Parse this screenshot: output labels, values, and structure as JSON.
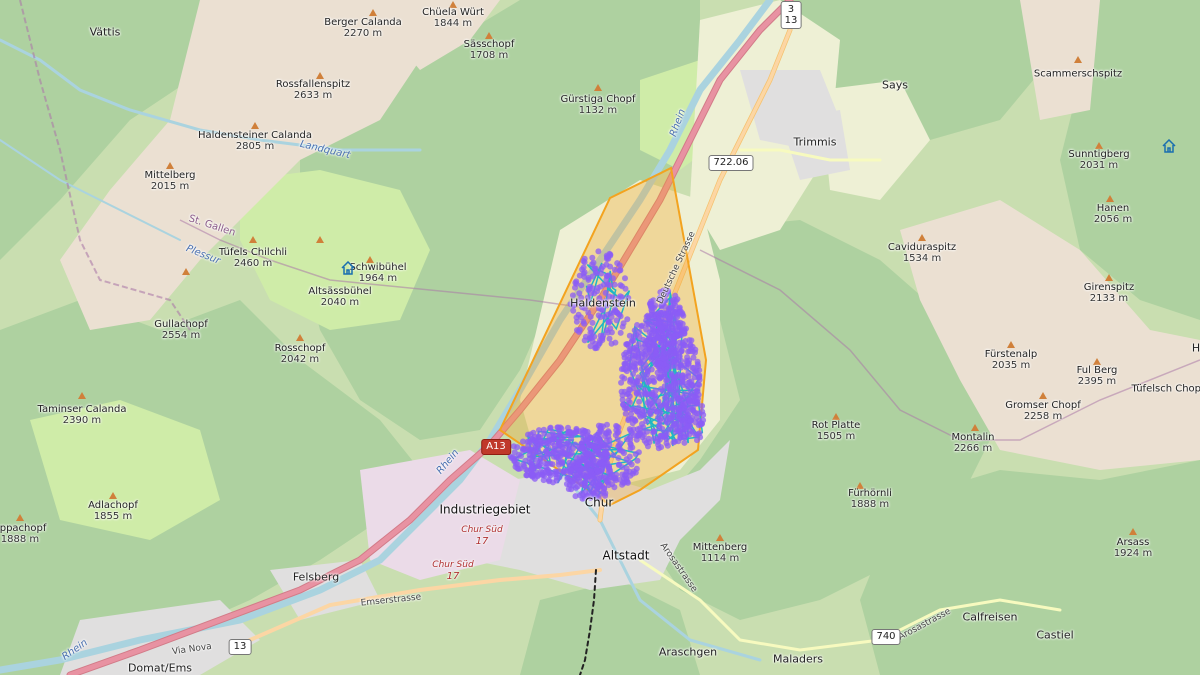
{
  "map": {
    "colors": {
      "forest": "#aed1a0",
      "meadow": "#cfeca8",
      "rock": "#ede3d6",
      "residential": "#e0dfdf",
      "industrial": "#ebdbe8",
      "farmland": "#eef0d5",
      "water": "#aad3df",
      "motorway": "#e892a2",
      "primary": "#fcd6a4",
      "secondary": "#f7fabf",
      "boundary": "#ac7aa8",
      "polygon_stroke": "#f3a31f",
      "polygon_fill": "#f3a31f",
      "cluster_line": "#1fb7c4",
      "point": "#8b5cf6"
    },
    "peaks": [
      {
        "name": "Berger Calanda",
        "elevation": "2270 m"
      },
      {
        "name": "Chüela Würt",
        "elevation": "1844 m"
      },
      {
        "name": "Sässchopf",
        "elevation": "1708 m"
      },
      {
        "name": "Rossfallenspitz",
        "elevation": "2633 m"
      },
      {
        "name": "Gürstiga Chopf",
        "elevation": "1132 m"
      },
      {
        "name": "Haldensteiner Calanda",
        "elevation": "2805 m"
      },
      {
        "name": "Mittelberg",
        "elevation": "2015 m"
      },
      {
        "name": "Tüfels Chilchli",
        "elevation": "2460 m"
      },
      {
        "name": "Schwibühel",
        "elevation": "1964 m"
      },
      {
        "name": "Altsässbühel",
        "elevation": "2040 m"
      },
      {
        "name": "Gullachopf",
        "elevation": "2554 m"
      },
      {
        "name": "Rosschopf",
        "elevation": "2042 m"
      },
      {
        "name": "Taminser Calanda",
        "elevation": "2390 m"
      },
      {
        "name": "Adlachopf",
        "elevation": "1855 m"
      },
      {
        "name": "oppachopf",
        "elevation": "1888 m"
      },
      {
        "name": "Scammerschspitz",
        "elevation": ""
      },
      {
        "name": "Sunntigberg",
        "elevation": "2031 m"
      },
      {
        "name": "Hanen",
        "elevation": "2056 m"
      },
      {
        "name": "Caviduraspitz",
        "elevation": "1534 m"
      },
      {
        "name": "Girenspitz",
        "elevation": "2133 m"
      },
      {
        "name": "Fürstenalp",
        "elevation": "2035 m"
      },
      {
        "name": "Ful Berg",
        "elevation": "2395 m"
      },
      {
        "name": "Tüfelsch Chopf",
        "elevation": ""
      },
      {
        "name": "Gromser Chopf",
        "elevation": "2258 m"
      },
      {
        "name": "Montalin",
        "elevation": "2266 m"
      },
      {
        "name": "Rot Platte",
        "elevation": "1505 m"
      },
      {
        "name": "Fürhörnli",
        "elevation": "1888 m"
      },
      {
        "name": "Mittenberg",
        "elevation": "1114 m"
      },
      {
        "name": "Arsass",
        "elevation": "1924 m"
      }
    ],
    "places": {
      "vattis": "Vättis",
      "says": "Says",
      "trimmis": "Trimmis",
      "haldenstein": "Haldenstein",
      "industriegebiet": "Industriegebiet",
      "altstadt": "Altstadt",
      "chur": "Chur",
      "felsberg": "Felsberg",
      "domat_ems": "Domat/Ems",
      "araschgen": "Araschgen",
      "maladers": "Maladers",
      "calfreisen": "Calfreisen",
      "castiel": "Castiel",
      "h_edge": "H"
    },
    "rivers": {
      "landquart": "Landquart",
      "rhein_upper": "Rhein",
      "rhein_lower": "Rhein",
      "rhein_bottom": "Rhein",
      "plessur": "Plessur"
    },
    "boundaries": {
      "st_gallen": "St. Gallen"
    },
    "streets": {
      "deutsche_strasse": "Deutsche Strasse",
      "emserstrasse": "Emserstrasse",
      "via_nova": "Via Nova",
      "arosastrasse_1": "Arosastrasse",
      "arosastrasse_2": "Arosastrasse",
      "chur_sud_1": "Chur Süd",
      "chur_sud_1_num": "17",
      "chur_sud_2": "Chur Süd",
      "chur_sud_2_num": "17"
    },
    "shields": {
      "route_3": "3",
      "route_13_top": "13",
      "route_722": "722.06",
      "a13": "A13",
      "route_13_bottom": "13",
      "route_740": "740"
    },
    "overlay": {
      "point_count_visible": 0
    }
  }
}
